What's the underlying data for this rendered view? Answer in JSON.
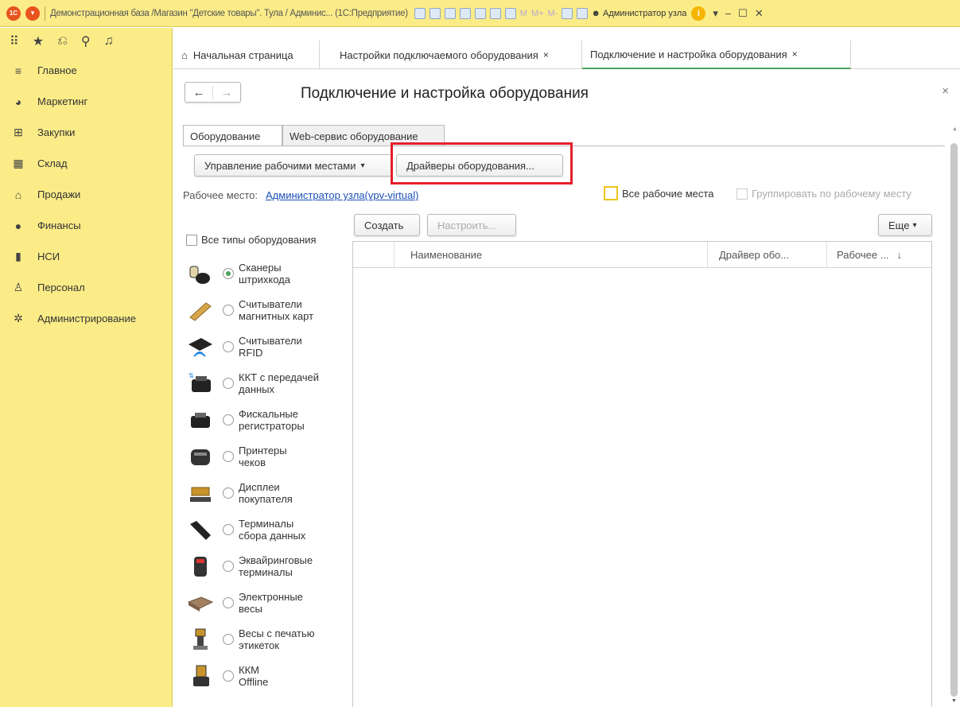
{
  "titlebar": {
    "title": "Демонстрационная база /Магазин \"Детские товары\". Тула / Админис... (1С:Предприятие)",
    "m_labels": [
      "M",
      "M+",
      "M-"
    ],
    "user": "Администратор узла"
  },
  "sidebar": {
    "items": [
      {
        "label": "Главное",
        "icon": "menu-lines-icon"
      },
      {
        "label": "Маркетинг",
        "icon": "pie-icon"
      },
      {
        "label": "Закупки",
        "icon": "cart-icon"
      },
      {
        "label": "Склад",
        "icon": "warehouse-icon"
      },
      {
        "label": "Продажи",
        "icon": "basket-icon"
      },
      {
        "label": "Финансы",
        "icon": "coin-icon"
      },
      {
        "label": "НСИ",
        "icon": "book-icon"
      },
      {
        "label": "Персонал",
        "icon": "person-icon"
      },
      {
        "label": "Администрирование",
        "icon": "gear-icon"
      }
    ]
  },
  "tabs": {
    "home": "Начальная страница",
    "t1": "Настройки подключаемого оборудования",
    "t2": "Подключение и настройка оборудования",
    "close": "×"
  },
  "content": {
    "title": "Подключение и настройка оборудования",
    "form_tabs": [
      "Оборудование",
      "Web-сервис оборудование"
    ],
    "manage_btn": "Управление рабочими местами",
    "drivers_btn": "Драйверы оборудования...",
    "wp_label": "Рабочее место:",
    "wp_value": "Администратор узла(vpv-virtual)",
    "all_wp": "Все рабочие места",
    "group_wp": "Группировать по рабочему месту",
    "create_btn": "Создать",
    "setup_btn": "Настроить...",
    "more_btn": "Еще",
    "all_types": "Все типы оборудования"
  },
  "equipment": [
    {
      "l1": "Сканеры",
      "l2": "штрихкода",
      "selected": true
    },
    {
      "l1": "Считыватели",
      "l2": "магнитных карт",
      "selected": false
    },
    {
      "l1": "Считыватели",
      "l2": "RFID",
      "selected": false
    },
    {
      "l1": "ККТ с передачей",
      "l2": "данных",
      "selected": false
    },
    {
      "l1": "Фискальные",
      "l2": "регистраторы",
      "selected": false
    },
    {
      "l1": "Принтеры",
      "l2": "чеков",
      "selected": false
    },
    {
      "l1": "Дисплеи",
      "l2": "покупателя",
      "selected": false
    },
    {
      "l1": "Терминалы",
      "l2": "сбора данных",
      "selected": false
    },
    {
      "l1": "Эквайринговые",
      "l2": "терминалы",
      "selected": false
    },
    {
      "l1": "Электронные",
      "l2": "весы",
      "selected": false
    },
    {
      "l1": "Весы с печатью",
      "l2": "этикеток",
      "selected": false
    },
    {
      "l1": "ККМ",
      "l2": "Offline",
      "selected": false
    }
  ],
  "table": {
    "col_name": "Наименование",
    "col_driver": "Драйвер обо...",
    "col_wp": "Рабочее ...",
    "sort_arrow": "↓"
  }
}
